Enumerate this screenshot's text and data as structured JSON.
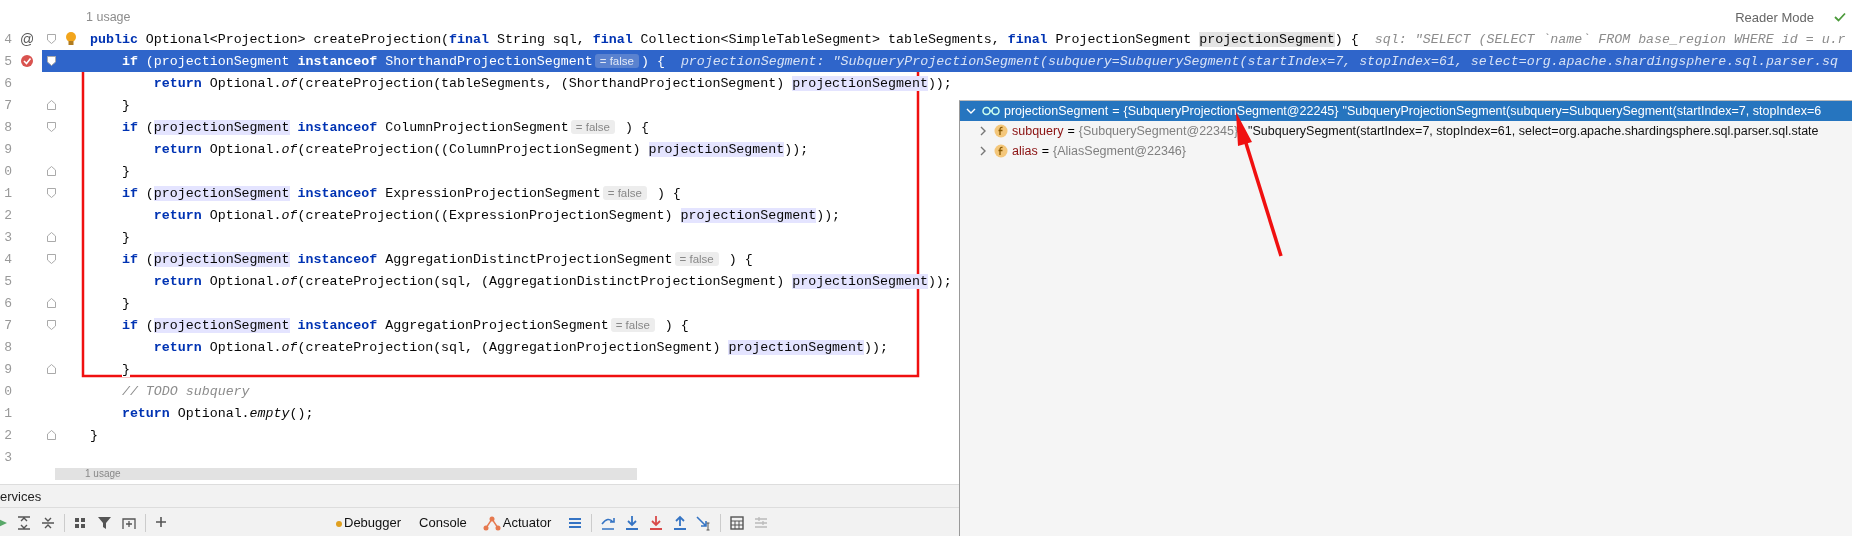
{
  "reader_mode": "Reader Mode",
  "lens_top": "1 usage",
  "lines": [
    {
      "number": "4",
      "selected": false,
      "gutter": {
        "kind": "text",
        "text": "@"
      },
      "bulb": true,
      "fold_open": true,
      "segments": [
        {
          "kind": "keyword",
          "text": "public"
        },
        {
          "kind": "plain",
          "text": " Optional<Projection> createProjection("
        },
        {
          "kind": "keyword",
          "text": "final"
        },
        {
          "kind": "plain",
          "text": " String sql, "
        },
        {
          "kind": "keyword",
          "text": "final"
        },
        {
          "kind": "plain",
          "text": " Collection<SimpleTableSegment> tableSegments, "
        },
        {
          "kind": "keyword",
          "text": "final"
        },
        {
          "kind": "plain",
          "text": " ProjectionSegment "
        },
        {
          "kind": "param",
          "text": "projectionSegment"
        },
        {
          "kind": "plain",
          "text": ") {"
        },
        {
          "kind": "hint",
          "text": "sql: \"SELECT (SELECT `name` FROM base_region WHERE id = u.r"
        }
      ],
      "children": [
        {
          "number": "5",
          "selected": true,
          "gutter": {
            "kind": "breakpoint"
          },
          "fold_open": true,
          "segments": [
            {
              "kind": "keyword",
              "text": "if"
            },
            {
              "kind": "plain",
              "text": " (projectionSegment"
            },
            {
              "kind": "keyword",
              "text": " instanceof"
            },
            {
              "kind": "plain",
              "text": " ShorthandProjectionSegment"
            },
            {
              "kind": "inlay",
              "text": "= false"
            },
            {
              "kind": "plain",
              "text": ") {"
            },
            {
              "kind": "hint",
              "text": "projectionSegment: \"SubqueryProjectionSegment(subquery=SubquerySegment(startIndex=7, stopIndex=61, select=org.apache.shardingsphere.sql.parser.sq"
            }
          ],
          "children": [
            {
              "number": "6",
              "selected": false,
              "segments": [
                {
                  "kind": "keyword",
                  "text": "return"
                },
                {
                  "kind": "plain",
                  "text": " Optional."
                },
                {
                  "kind": "method",
                  "text": "of"
                },
                {
                  "kind": "plain",
                  "text": "(createProjection(tableSegments, (ShorthandProjectionSegment) "
                },
                {
                  "kind": "usage",
                  "text": "projectionSegment"
                },
                {
                  "kind": "plain",
                  "text": "));"
                }
              ]
            }
          ]
        },
        {
          "number": "7",
          "selected": false,
          "fold_close": true,
          "segments": [
            {
              "kind": "plain",
              "text": "}"
            }
          ]
        },
        {
          "number": "8",
          "selected": false,
          "fold_open": true,
          "segments": [
            {
              "kind": "keyword",
              "text": "if"
            },
            {
              "kind": "plain",
              "text": " ("
            },
            {
              "kind": "usage",
              "text": "projectionSegment"
            },
            {
              "kind": "keyword",
              "text": " instanceof"
            },
            {
              "kind": "plain",
              "text": " ColumnProjectionSegment"
            },
            {
              "kind": "inlay",
              "text": "= false"
            },
            {
              "kind": "plain",
              "text": " ) {"
            }
          ],
          "children": [
            {
              "number": "9",
              "selected": false,
              "segments": [
                {
                  "kind": "keyword",
                  "text": "return"
                },
                {
                  "kind": "plain",
                  "text": " Optional."
                },
                {
                  "kind": "method",
                  "text": "of"
                },
                {
                  "kind": "plain",
                  "text": "(createProjection((ColumnProjectionSegment) "
                },
                {
                  "kind": "usage",
                  "text": "projectionSegment"
                },
                {
                  "kind": "plain",
                  "text": "));"
                }
              ]
            }
          ]
        },
        {
          "number": "0",
          "selected": false,
          "fold_close": true,
          "segments": [
            {
              "kind": "plain",
              "text": "}"
            }
          ]
        },
        {
          "number": "1",
          "selected": false,
          "fold_open": true,
          "segments": [
            {
              "kind": "keyword",
              "text": "if"
            },
            {
              "kind": "plain",
              "text": " ("
            },
            {
              "kind": "usage",
              "text": "projectionSegment"
            },
            {
              "kind": "keyword",
              "text": " instanceof"
            },
            {
              "kind": "plain",
              "text": " ExpressionProjectionSegment"
            },
            {
              "kind": "inlay",
              "text": "= false"
            },
            {
              "kind": "plain",
              "text": " ) {"
            }
          ],
          "children": [
            {
              "number": "2",
              "selected": false,
              "segments": [
                {
                  "kind": "keyword",
                  "text": "return"
                },
                {
                  "kind": "plain",
                  "text": " Optional."
                },
                {
                  "kind": "method",
                  "text": "of"
                },
                {
                  "kind": "plain",
                  "text": "(createProjection((ExpressionProjectionSegment) "
                },
                {
                  "kind": "usage",
                  "text": "projectionSegment"
                },
                {
                  "kind": "plain",
                  "text": "));"
                }
              ]
            }
          ]
        },
        {
          "number": "3",
          "selected": false,
          "fold_close": true,
          "segments": [
            {
              "kind": "plain",
              "text": "}"
            }
          ]
        },
        {
          "number": "4",
          "selected": false,
          "fold_open": true,
          "segments": [
            {
              "kind": "keyword",
              "text": "if"
            },
            {
              "kind": "plain",
              "text": " ("
            },
            {
              "kind": "usage",
              "text": "projectionSegment"
            },
            {
              "kind": "keyword",
              "text": " instanceof"
            },
            {
              "kind": "plain",
              "text": " AggregationDistinctProjectionSegment"
            },
            {
              "kind": "inlay",
              "text": "= false"
            },
            {
              "kind": "plain",
              "text": " ) {"
            }
          ],
          "children": [
            {
              "number": "5",
              "selected": false,
              "segments": [
                {
                  "kind": "keyword",
                  "text": "return"
                },
                {
                  "kind": "plain",
                  "text": " Optional."
                },
                {
                  "kind": "method",
                  "text": "of"
                },
                {
                  "kind": "plain",
                  "text": "(createProjection(sql, (AggregationDistinctProjectionSegment) "
                },
                {
                  "kind": "usage",
                  "text": "projectionSegment"
                },
                {
                  "kind": "plain",
                  "text": "));"
                }
              ]
            }
          ]
        },
        {
          "number": "6",
          "selected": false,
          "fold_close": true,
          "segments": [
            {
              "kind": "plain",
              "text": "}"
            }
          ]
        },
        {
          "number": "7",
          "selected": false,
          "fold_open": true,
          "segments": [
            {
              "kind": "keyword",
              "text": "if"
            },
            {
              "kind": "plain",
              "text": " ("
            },
            {
              "kind": "usage",
              "text": "projectionSegment"
            },
            {
              "kind": "keyword",
              "text": " instanceof"
            },
            {
              "kind": "plain",
              "text": " AggregationProjectionSegment"
            },
            {
              "kind": "inlay",
              "text": "= false"
            },
            {
              "kind": "plain",
              "text": " ) {"
            }
          ],
          "children": [
            {
              "number": "8",
              "selected": false,
              "segments": [
                {
                  "kind": "keyword",
                  "text": "return"
                },
                {
                  "kind": "plain",
                  "text": " Optional."
                },
                {
                  "kind": "method",
                  "text": "of"
                },
                {
                  "kind": "plain",
                  "text": "(createProjection(sql, (AggregationProjectionSegment) "
                },
                {
                  "kind": "usage",
                  "text": "projectionSegment"
                },
                {
                  "kind": "plain",
                  "text": "));"
                }
              ]
            }
          ]
        },
        {
          "number": "9",
          "selected": false,
          "fold_close": true,
          "segments": [
            {
              "kind": "plain",
              "text": "}"
            }
          ]
        },
        {
          "number": "0",
          "selected": false,
          "segments": [
            {
              "kind": "comment",
              "text": "// TODO subquery"
            }
          ]
        },
        {
          "number": "1",
          "selected": false,
          "segments": [
            {
              "kind": "keyword",
              "text": "return"
            },
            {
              "kind": "plain",
              "text": " Optional."
            },
            {
              "kind": "method",
              "text": "empty"
            },
            {
              "kind": "plain",
              "text": "();"
            }
          ]
        }
      ]
    },
    {
      "number": "2",
      "selected": false,
      "fold_close": true,
      "segments": [
        {
          "kind": "plain",
          "text": "}"
        }
      ]
    },
    {
      "number": "3",
      "selected": false
    }
  ],
  "lens_bottom": "1 usage",
  "services": {
    "title": "ervices",
    "tabs": [
      {
        "label": "Debugger",
        "kind": "debugger"
      },
      {
        "label": "Console",
        "kind": "plain"
      },
      {
        "label": "Actuator",
        "kind": "actuator"
      }
    ]
  },
  "debugger": {
    "rows": [
      {
        "kind": "watch",
        "expanded": true,
        "selected": true,
        "name": "projectionSegment",
        "op": "=",
        "value": "{SubqueryProjectionSegment@22245}",
        "text": "\"SubqueryProjectionSegment(subquery=SubquerySegment(startIndex=7, stopIndex=6"
      },
      {
        "kind": "field",
        "expanded": false,
        "selected": false,
        "name": "subquery",
        "op": "=",
        "value": "{SubquerySegment@22345}",
        "text": "\"SubquerySegment(startIndex=7, stopIndex=61, select=org.apache.shardingsphere.sql.parser.sql.state"
      },
      {
        "kind": "field",
        "expanded": false,
        "selected": false,
        "name": "alias",
        "op": "=",
        "value": "{AliasSegment@22346}"
      }
    ]
  }
}
